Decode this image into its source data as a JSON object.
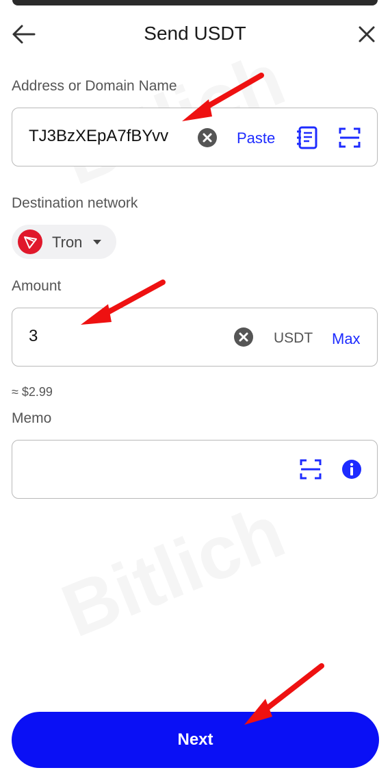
{
  "header": {
    "title": "Send USDT",
    "back_icon": "arrow-left-icon",
    "close_icon": "close-icon"
  },
  "address": {
    "label": "Address or Domain Name",
    "value": "TJ3BzXEpA7fBYvv",
    "paste_label": "Paste",
    "icons": [
      "clear-icon",
      "address-book-icon",
      "scan-icon"
    ]
  },
  "network": {
    "label": "Destination network",
    "selected": "Tron",
    "icon": "tron-logo"
  },
  "amount": {
    "label": "Amount",
    "value": "3",
    "unit": "USDT",
    "max_label": "Max",
    "approx": "≈ $2.99"
  },
  "memo": {
    "label": "Memo",
    "value": "",
    "icons": [
      "scan-icon",
      "info-icon"
    ]
  },
  "footer": {
    "next_label": "Next"
  },
  "watermark": "Bitlich",
  "colors": {
    "accent": "#0a10f5",
    "link": "#1d2bff",
    "arrow": "#ee1111",
    "tron": "#e0182b"
  }
}
